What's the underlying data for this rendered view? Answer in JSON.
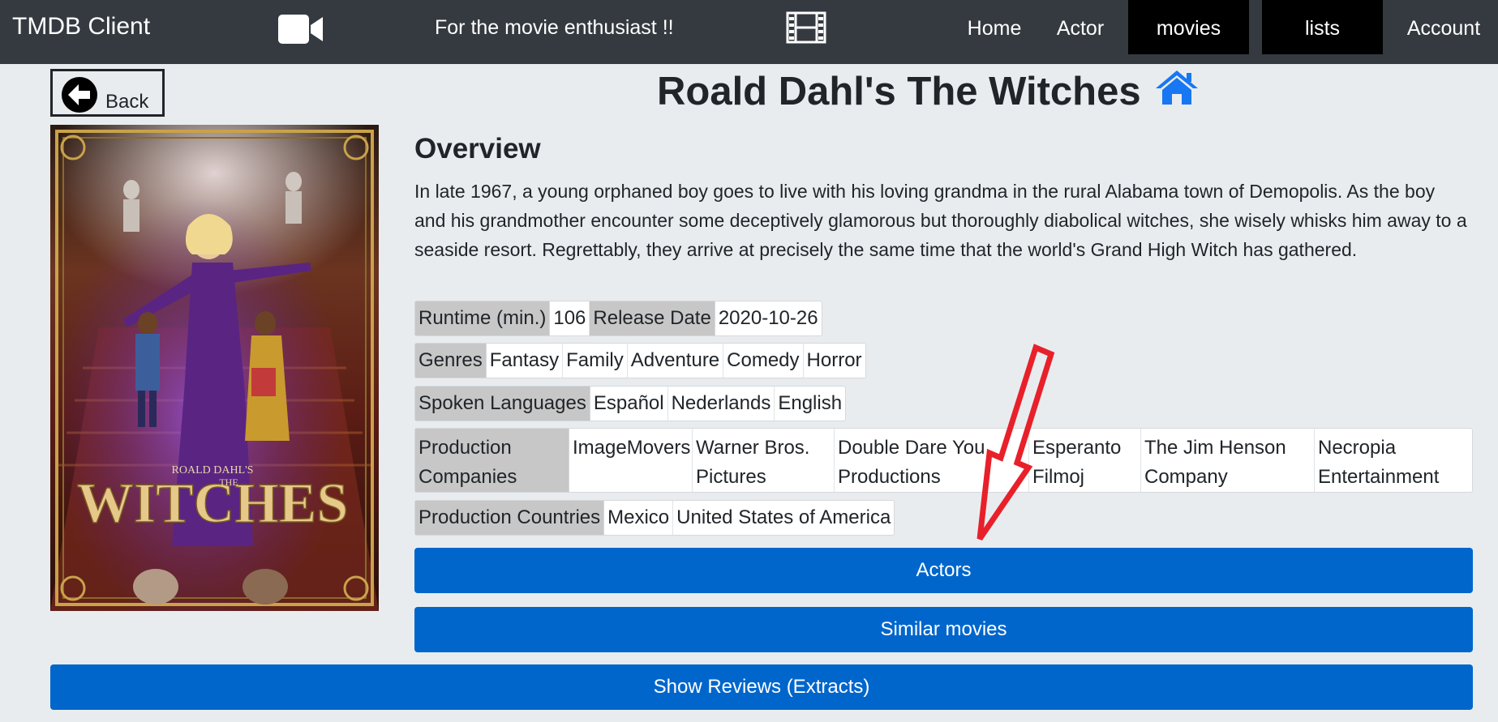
{
  "navbar": {
    "brand": "TMDB Client",
    "camera_icon": "video-camera-icon",
    "tagline": "For the movie enthusiast !!",
    "film_icon": "film-strip-icon",
    "links": {
      "home": "Home",
      "actor": "Actor",
      "movies": "movies",
      "lists": "lists",
      "account": "Account"
    }
  },
  "back": {
    "label": "Back",
    "icon": "arrow-left-circle-icon"
  },
  "movie": {
    "title": "Roald Dahl's The Witches",
    "home_icon": "home-icon",
    "poster": {
      "brand_text": "ROALD DAHL'S",
      "title_text": "WITCHES",
      "the_text": "THE"
    },
    "overview_heading": "Overview",
    "overview": "In late 1967, a young orphaned boy goes to live with his loving grandma in the rural Alabama town of Demopolis. As the boy and his grandmother encounter some deceptively glamorous but thoroughly diabolical witches, she wisely whisks him away to a seaside resort. Regrettably, they arrive at precisely the same time that the world's Grand High Witch has gathered.",
    "runtime_label": "Runtime (min.)",
    "runtime": "106",
    "release_label": "Release Date",
    "release_date": "2020-10-26",
    "genres_label": "Genres",
    "genres": [
      "Fantasy",
      "Family",
      "Adventure",
      "Comedy",
      "Horror"
    ],
    "languages_label": "Spoken Languages",
    "languages": [
      "Español",
      "Nederlands",
      "English"
    ],
    "companies_label": "Production Companies",
    "companies": [
      "ImageMovers",
      "Warner Bros. Pictures",
      "Double Dare You Productions",
      "Esperanto Filmoj",
      "The Jim Henson Company",
      "Necropia Entertainment"
    ],
    "countries_label": "Production Countries",
    "countries": [
      "Mexico",
      "United States of America"
    ]
  },
  "buttons": {
    "actors": "Actors",
    "similar": "Similar movies",
    "reviews": "Show Reviews (Extracts)"
  },
  "annotation": {
    "color": "#e8202a"
  },
  "colors": {
    "navbar": "#343a40",
    "primary": "#0066cc",
    "active_nav": "#000000",
    "label_bg": "#c7c7c7"
  }
}
